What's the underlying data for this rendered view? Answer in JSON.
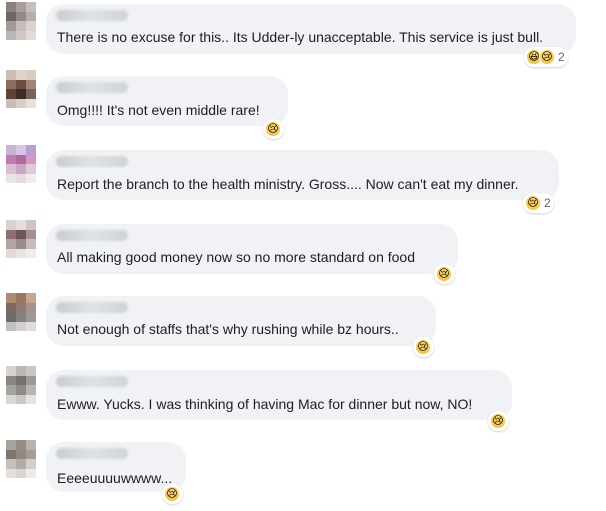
{
  "comments": [
    {
      "text": "There is no excuse for this.. Its Udder-ly unacceptable. This service is just bull.",
      "reactions": [
        {
          "icon": "haha-emoji-icon",
          "glyph": "😆"
        },
        {
          "icon": "sad-emoji-icon",
          "glyph": "😢"
        }
      ],
      "count": "2",
      "avatar_colors": [
        "#8a8280",
        "#a7a09b",
        "#c7bfba",
        "#6e6763",
        "#93898a",
        "#b5aea9",
        "#a29b97",
        "#c3beba",
        "#d8d3cf",
        "#bdb7b3",
        "#cfcac6",
        "#e0dcd9"
      ]
    },
    {
      "text": "Omg!!!! It's not even middle rare!",
      "reactions": [
        {
          "icon": "sad-emoji-icon",
          "glyph": "😢"
        }
      ],
      "count": "",
      "avatar_colors": [
        "#cdbcb3",
        "#e0d3cb",
        "#d9cbc2",
        "#8e6d5c",
        "#6d4f41",
        "#a0867a",
        "#5c4438",
        "#3d2d25",
        "#7a6256",
        "#c9bcb4",
        "#d9cfc9",
        "#e6dfda"
      ]
    },
    {
      "text": "Report the branch to the health ministry. Gross.... Now can't eat my dinner.",
      "reactions": [
        {
          "icon": "sad-emoji-icon",
          "glyph": "😢"
        }
      ],
      "count": "2",
      "avatar_colors": [
        "#c7b2d8",
        "#d8c5e5",
        "#b99fd0",
        "#c27ab0",
        "#b368a2",
        "#d09ac4",
        "#d8c0cf",
        "#c9a9c1",
        "#e1cad8",
        "#ece3ea",
        "#e5dae3",
        "#f1ecf0"
      ]
    },
    {
      "text": "All making good money now so no more standard on food",
      "reactions": [
        {
          "icon": "sad-emoji-icon",
          "glyph": "😢"
        }
      ],
      "count": "",
      "avatar_colors": [
        "#d7d1cf",
        "#e3dfdd",
        "#cfc6c3",
        "#8c6f72",
        "#6f5558",
        "#a38f91",
        "#b3a4a4",
        "#9d8b8b",
        "#c7bcbb",
        "#e0dbda",
        "#e8e4e3",
        "#efecec"
      ]
    },
    {
      "text": "Not enough of staffs that's why rushing while bz hours..",
      "reactions": [
        {
          "icon": "sad-emoji-icon",
          "glyph": "😢"
        }
      ],
      "count": "",
      "avatar_colors": [
        "#b08a73",
        "#9c7560",
        "#c7a58f",
        "#7d6b62",
        "#8f7d74",
        "#a69288",
        "#6e6a68",
        "#858180",
        "#9d9998",
        "#c3bfbd",
        "#d2cfcd",
        "#dfdcdb"
      ]
    },
    {
      "text": "Ewww. Yucks. I was thinking of having Mac for dinner but now, NO!",
      "reactions": [
        {
          "icon": "sad-emoji-icon",
          "glyph": "😢"
        }
      ],
      "count": "",
      "avatar_colors": [
        "#d6d2d0",
        "#bdb7b4",
        "#cbc6c3",
        "#8a8583",
        "#76706e",
        "#9e9896",
        "#a7a3a1",
        "#8f8a88",
        "#b9b5b3",
        "#d9d6d4",
        "#cbc7c5",
        "#e5e2e1"
      ]
    },
    {
      "text": "Eeeeuuuuwwww...",
      "reactions": [
        {
          "icon": "sad-emoji-icon",
          "glyph": "😢"
        }
      ],
      "count": "",
      "avatar_colors": [
        "#a9a29c",
        "#948c86",
        "#b9b2ad",
        "#7d7670",
        "#918a84",
        "#a49d98",
        "#c6c0bc",
        "#b2aca7",
        "#d4cfcb",
        "#e3dfdc",
        "#d9d5d2",
        "#eeebe9"
      ]
    }
  ]
}
